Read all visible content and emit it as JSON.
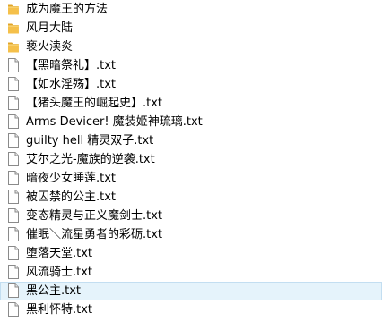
{
  "items": [
    {
      "name": "成为魔王的方法",
      "type": "folder"
    },
    {
      "name": "风月大陆",
      "type": "folder"
    },
    {
      "name": "亵火渎炎",
      "type": "folder"
    },
    {
      "name": "【黑暗祭礼】.txt",
      "type": "file"
    },
    {
      "name": "【如水淫殇】.txt",
      "type": "file"
    },
    {
      "name": "【猪头魔王的崛起史】.txt",
      "type": "file"
    },
    {
      "name": "Arms Devicer! 魔装姬神琉璃.txt",
      "type": "file"
    },
    {
      "name": "guilty hell 精灵双子.txt",
      "type": "file"
    },
    {
      "name": "艾尔之光-魔族的逆袭.txt",
      "type": "file"
    },
    {
      "name": "暗夜少女睡莲.txt",
      "type": "file"
    },
    {
      "name": "被囚禁的公主.txt",
      "type": "file"
    },
    {
      "name": "变态精灵与正义魔剑士.txt",
      "type": "file"
    },
    {
      "name": "催眠＼流星勇者的彩砺.txt",
      "type": "file"
    },
    {
      "name": "堕落天堂.txt",
      "type": "file"
    },
    {
      "name": "风流骑士.txt",
      "type": "file"
    },
    {
      "name": "黑公主.txt",
      "type": "file",
      "selected": true
    },
    {
      "name": "黑利怀特.txt",
      "type": "file"
    }
  ],
  "colors": {
    "folder_fill": "#f5c04a",
    "folder_tab": "#e0a528",
    "file_fill": "#ffffff",
    "file_stroke": "#8a8a8a",
    "selection_bg": "#e5f3fb",
    "selection_border": "#c3def1"
  }
}
